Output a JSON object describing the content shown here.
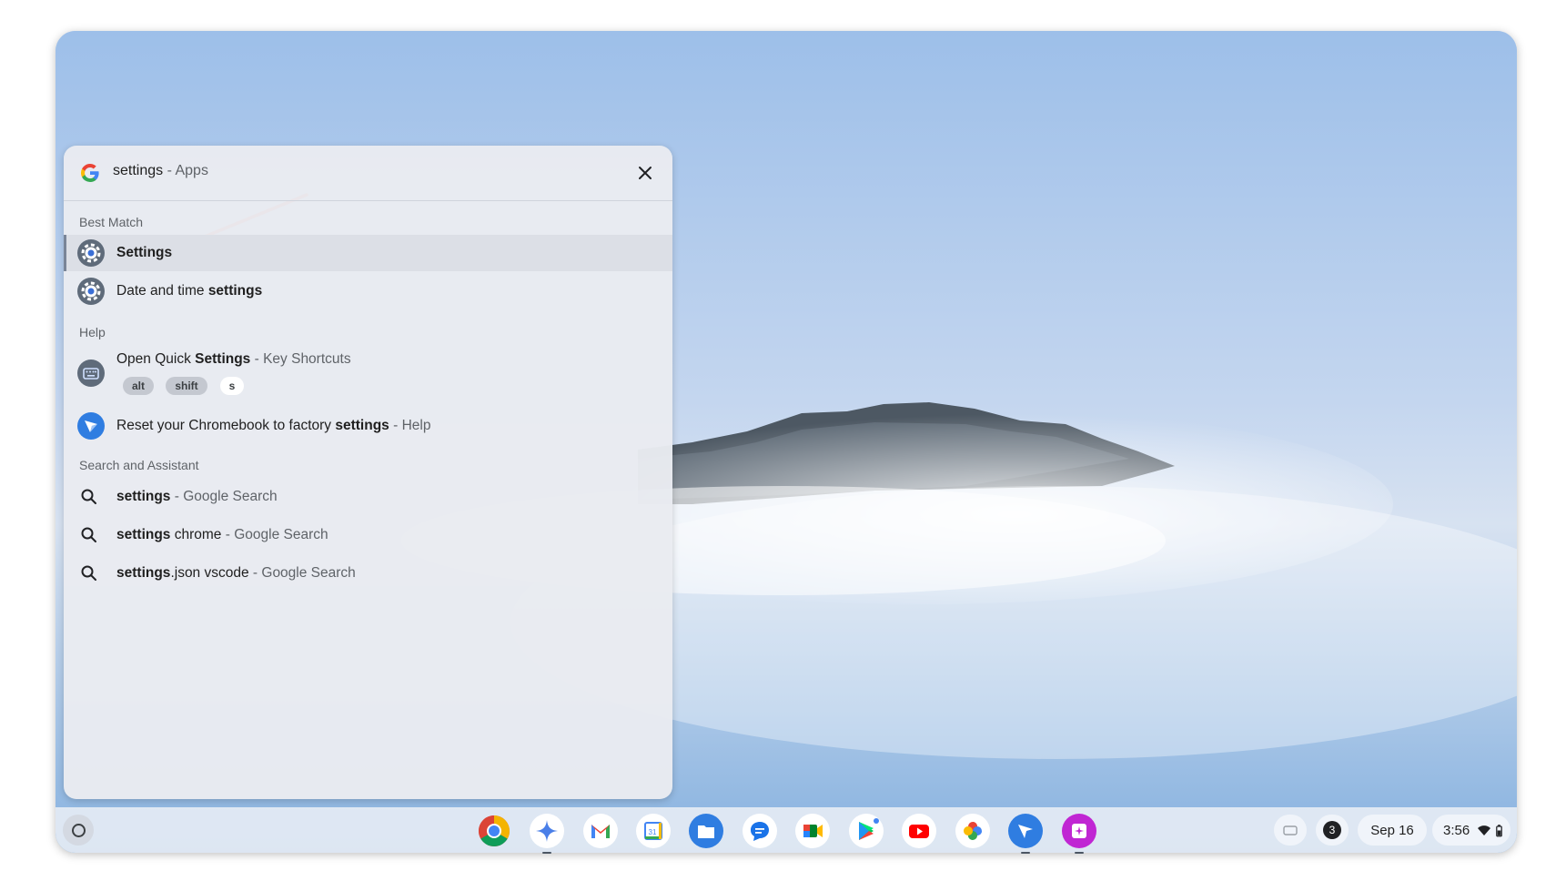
{
  "search": {
    "query": "settings",
    "scope": " - Apps"
  },
  "sections": {
    "best_match": "Best Match",
    "help": "Help",
    "search_assistant": "Search and Assistant"
  },
  "best_match_items": [
    {
      "pre": "",
      "bold": "Settings",
      "post": ""
    },
    {
      "pre": "Date and time ",
      "bold": "settings",
      "post": ""
    }
  ],
  "help_items": [
    {
      "pre": "Open Quick ",
      "bold": "Settings",
      "post": " - Key Shortcuts",
      "keys": [
        "alt",
        "shift",
        "s"
      ]
    },
    {
      "pre": "Reset your Chromebook to factory ",
      "bold": "settings",
      "post": " - Help"
    }
  ],
  "search_items": [
    {
      "bold": "settings",
      "mid": "",
      "post": " - Google Search"
    },
    {
      "bold": "settings",
      "mid": " chrome",
      "post": " - Google Search"
    },
    {
      "bold": "settings",
      "mid": ".json vscode",
      "post": " - Google Search"
    }
  ],
  "shelf": {
    "apps": [
      "chrome-icon",
      "gemini-icon",
      "gmail-icon",
      "calendar-icon",
      "files-icon",
      "messages-icon",
      "meet-icon",
      "play-store-icon",
      "youtube-icon",
      "photos-icon",
      "explore-icon",
      "screencast-icon"
    ],
    "notification_count": "3",
    "date": "Sep 16",
    "time": "3:56"
  },
  "colors": {
    "accent_arrow": "#e53935",
    "panel": "#e9ebf1",
    "selected_row": "#dcdfe6"
  }
}
